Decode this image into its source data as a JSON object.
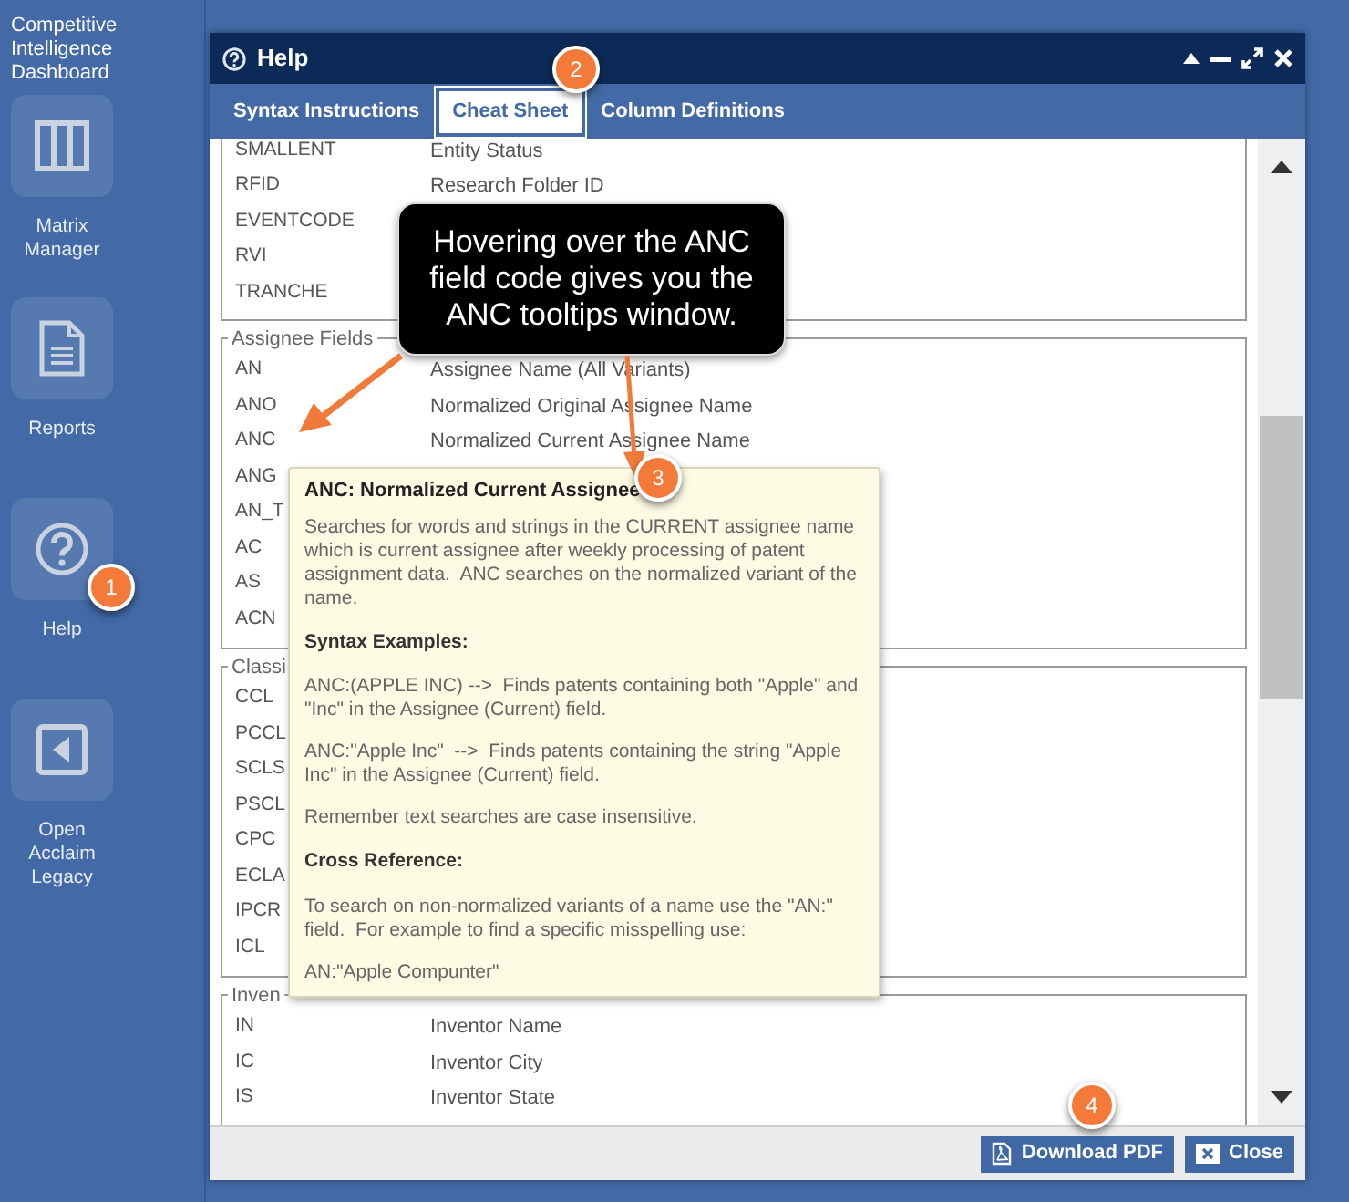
{
  "sidebar": {
    "title": "Competitive Intelligence Dashboard",
    "items": [
      {
        "kind": "matrix",
        "label": "Matrix Manager"
      },
      {
        "kind": "report",
        "label": "Reports"
      },
      {
        "kind": "help",
        "label": "Help"
      },
      {
        "kind": "back",
        "label": "Open Acclaim Legacy"
      }
    ]
  },
  "window": {
    "title": "Help"
  },
  "tabs": [
    {
      "label": "Syntax Instructions",
      "selected": false
    },
    {
      "label": "Cheat Sheet",
      "selected": true
    },
    {
      "label": "Column Definitions",
      "selected": false
    }
  ],
  "groups": [
    {
      "rows": [
        {
          "code": "SMALLENT",
          "description": "Entity Status"
        },
        {
          "code": "RFID",
          "description": "Research Folder ID"
        },
        {
          "code": "EVENTCODE"
        },
        {
          "code": "RVI"
        },
        {
          "code": "TRANCHE"
        }
      ]
    },
    {
      "legend": "Assignee Fields",
      "rows": [
        {
          "code": "AN",
          "description": "Assignee Name (All Variants)"
        },
        {
          "code": "ANO",
          "description": "Normalized Original Assignee Name"
        },
        {
          "code": "ANC",
          "description": "Normalized Current Assignee Name"
        },
        {
          "code": "ANG"
        },
        {
          "code": "AN_T"
        },
        {
          "code": "AC"
        },
        {
          "code": "AS"
        },
        {
          "code": "ACN"
        }
      ]
    },
    {
      "legend": "Classi",
      "rows": [
        {
          "code": "CCL"
        },
        {
          "code": "PCCL"
        },
        {
          "code": "SCLS"
        },
        {
          "code": "PSCL"
        },
        {
          "code": "CPC"
        },
        {
          "code": "ECLA"
        },
        {
          "code": "IPCR"
        },
        {
          "code": "ICL"
        }
      ]
    },
    {
      "legend": "Inven",
      "rows": [
        {
          "code": "IN",
          "description": "Inventor Name"
        },
        {
          "code": "IC",
          "description": "Inventor City"
        },
        {
          "code": "IS",
          "description": "Inventor State"
        }
      ]
    }
  ],
  "tooltip": {
    "title": "ANC: Normalized Current Assignee",
    "blocks": [
      {
        "kind": "text",
        "text": "Searches for words and strings in the CURRENT assignee name which is current assignee after weekly processing of patent assignment data.  ANC searches on the normalized variant of the name."
      },
      {
        "kind": "heading",
        "text": "Syntax Examples:"
      },
      {
        "kind": "text",
        "text": "ANC:(APPLE INC) -->  Finds patents containing both \"Apple\" and \"Inc\" in the Assignee (Current) field."
      },
      {
        "kind": "text",
        "text": "ANC:\"Apple Inc\"  -->  Finds patents containing the string \"Apple Inc\" in the Assignee (Current) field."
      },
      {
        "kind": "text",
        "text": "Remember text searches are case insensitive."
      },
      {
        "kind": "heading",
        "text": "Cross Reference:"
      },
      {
        "kind": "text",
        "text": "To search on non-normalized variants of a name use the \"AN:\" field.  For example to find a specific misspelling use:"
      },
      {
        "kind": "text",
        "text": "AN:\"Apple Compunter\""
      }
    ]
  },
  "callout": {
    "text": "Hovering over the ANC field code gives you the ANC tooltips window."
  },
  "buttons": [
    {
      "kind": "pdf",
      "label": "Download PDF"
    },
    {
      "kind": "close",
      "label": "Close"
    }
  ],
  "badges": [
    "1",
    "2",
    "3",
    "4"
  ]
}
